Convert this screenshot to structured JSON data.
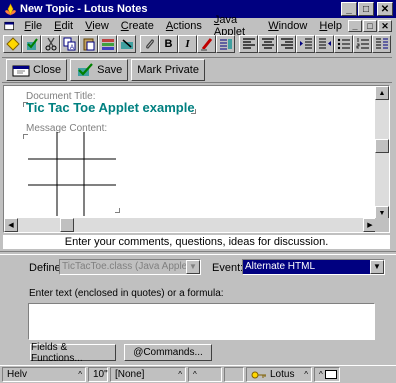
{
  "window": {
    "title": "New Topic - Lotus Notes",
    "controls": {
      "minimize": "_",
      "maximize": "□",
      "close": "✕"
    }
  },
  "menu": {
    "items": [
      "File",
      "Edit",
      "View",
      "Create",
      "Actions",
      "Java Applet",
      "Window",
      "Help"
    ],
    "underlines": [
      "F",
      "E",
      "V",
      "C",
      "A",
      "J",
      "W",
      "H"
    ]
  },
  "toolbar": {
    "bold": "B",
    "italic": "I"
  },
  "actions": {
    "close": "Close",
    "save": "Save",
    "mark_private": "Mark Private"
  },
  "document": {
    "title_label": "Document Title:",
    "title_value": "Tic Tac Toe Applet example",
    "content_label": "Message Content:"
  },
  "hint": "Enter your comments, questions, ideas for discussion.",
  "programmer": {
    "define_label": "Define:",
    "define_value": "TicTacToe.class (Java Applet)",
    "event_label": "Event:",
    "event_value": "Alternate HTML",
    "formula_label": "Enter text (enclosed in quotes) or a formula:",
    "formula_value": "",
    "fields_button": "Fields & Functions...",
    "commands_button": "@Commands..."
  },
  "status": {
    "font": "Helv",
    "size": "10\"",
    "style": "[None]",
    "location": "Lotus"
  },
  "colors": {
    "title_bar": "#000080",
    "title_value": "#008080",
    "event_highlight": "#000080"
  }
}
